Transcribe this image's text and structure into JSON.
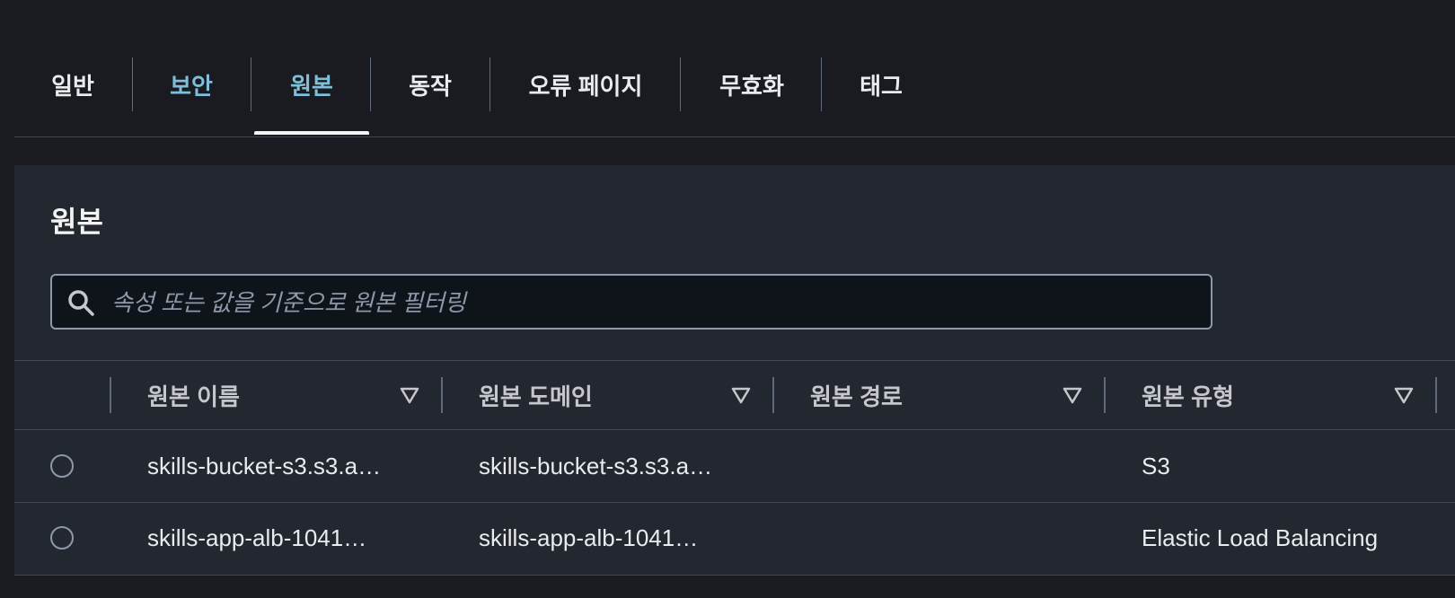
{
  "tabs": [
    {
      "label": "일반"
    },
    {
      "label": "보안"
    },
    {
      "label": "원본"
    },
    {
      "label": "동작"
    },
    {
      "label": "오류 페이지"
    },
    {
      "label": "무효화"
    },
    {
      "label": "태그"
    }
  ],
  "selected_tab": "원본",
  "container": {
    "title": "원본"
  },
  "search": {
    "placeholder": "속성 또는 값을 기준으로 원본 필터링",
    "value": ""
  },
  "table": {
    "columns": [
      "원본 이름",
      "원본 도메인",
      "원본 경로",
      "원본 유형"
    ],
    "rows": [
      {
        "name": "skills-bucket-s3.s3.a…",
        "domain": "skills-bucket-s3.s3.a…",
        "path": "",
        "type": "S3"
      },
      {
        "name": "skills-app-alb-1041…",
        "domain": "skills-app-alb-1041…",
        "path": "",
        "type": "Elastic Load Balancing"
      }
    ]
  },
  "colors": {
    "background": "#191b20",
    "container": "#232730",
    "accent": "#7fbfd9",
    "text": "#e9ebed"
  }
}
